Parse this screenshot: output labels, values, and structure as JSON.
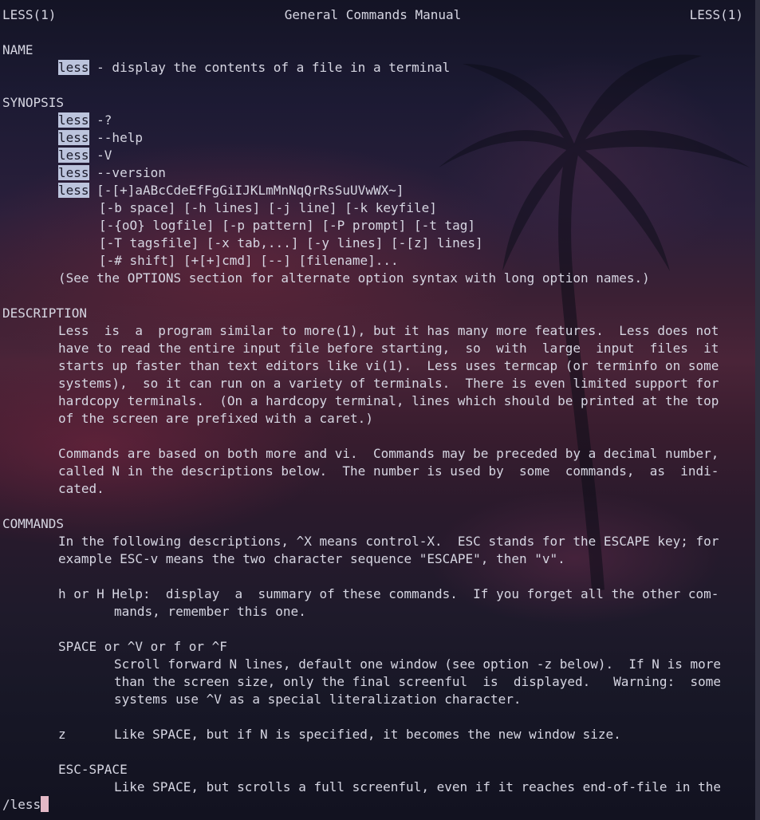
{
  "header": {
    "left": "LESS(1)",
    "center": "General Commands Manual",
    "right": "LESS(1)"
  },
  "name_section": {
    "heading": "NAME",
    "cmd": "less",
    "desc": " - display the contents of a file in a terminal"
  },
  "synopsis": {
    "heading": "SYNOPSIS",
    "cmd": "less",
    "forms": [
      " -?",
      " --help",
      " -V",
      " --version",
      " [-[+]aABcCdeEfFgGiIJKLmMnNqQrRsSuUVwWX~]"
    ],
    "continuation": [
      "[-b space] [-h lines] [-j line] [-k keyfile]",
      "[-{oO} logfile] [-p pattern] [-P prompt] [-t tag]",
      "[-T tagsfile] [-x tab,...] [-y lines] [-[z] lines]",
      "[-# shift] [+[+]cmd] [--] [filename]..."
    ],
    "note": "(See the OPTIONS section for alternate option syntax with long option names.)"
  },
  "description": {
    "heading": "DESCRIPTION",
    "p1": [
      "Less  is  a  program similar to more(1), but it has many more features.  Less does not",
      "have to read the entire input file before starting,  so  with  large  input  files  it",
      "starts up faster than text editors like vi(1).  Less uses termcap (or terminfo on some",
      "systems),  so it can run on a variety of terminals.  There is even limited support for",
      "hardcopy terminals.  (On a hardcopy terminal, lines which should be printed at the top",
      "of the screen are prefixed with a caret.)"
    ],
    "p2": [
      "Commands are based on both more and vi.  Commands may be preceded by a decimal number,",
      "called N in the descriptions below.  The number is used by  some  commands,  as  indi‐",
      "cated."
    ]
  },
  "commands": {
    "heading": "COMMANDS",
    "intro": [
      "In the following descriptions, ^X means control-X.  ESC stands for the ESCAPE key; for",
      "example ESC-v means the two character sequence \"ESCAPE\", then \"v\"."
    ],
    "help": {
      "first": "h or H Help:  display  a  summary of these commands.  If you forget all the other com‐",
      "second": "mands, remember this one."
    },
    "space": {
      "term": "SPACE or ^V or f or ^F",
      "desc": [
        "Scroll forward N lines, default one window (see option -z below).  If N is more",
        "than the screen size, only the final screenful  is  displayed.   Warning:  some",
        "systems use ^V as a special literalization character."
      ]
    },
    "z": {
      "term": "z",
      "desc": "Like SPACE, but if N is specified, it becomes the new window size."
    },
    "esc_space": {
      "term": "ESC-SPACE",
      "desc": "Like SPACE, but scrolls a full screenful, even if it reaches end-of-file in the"
    }
  },
  "prompt": {
    "text": "/less"
  }
}
